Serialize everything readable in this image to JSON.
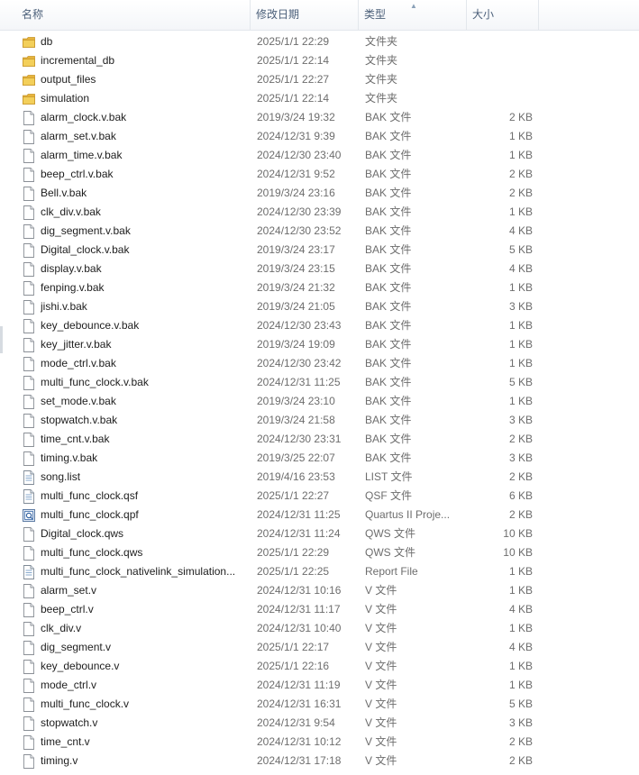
{
  "columns": {
    "name": "名称",
    "date": "修改日期",
    "type": "类型",
    "size": "大小"
  },
  "files": [
    {
      "name": "db",
      "date": "2025/1/1 22:29",
      "type": "文件夹",
      "size": "",
      "icon": "folder"
    },
    {
      "name": "incremental_db",
      "date": "2025/1/1 22:14",
      "type": "文件夹",
      "size": "",
      "icon": "folder"
    },
    {
      "name": "output_files",
      "date": "2025/1/1 22:27",
      "type": "文件夹",
      "size": "",
      "icon": "folder"
    },
    {
      "name": "simulation",
      "date": "2025/1/1 22:14",
      "type": "文件夹",
      "size": "",
      "icon": "folder"
    },
    {
      "name": "alarm_clock.v.bak",
      "date": "2019/3/24 19:32",
      "type": "BAK 文件",
      "size": "2 KB",
      "icon": "file"
    },
    {
      "name": "alarm_set.v.bak",
      "date": "2024/12/31 9:39",
      "type": "BAK 文件",
      "size": "1 KB",
      "icon": "file"
    },
    {
      "name": "alarm_time.v.bak",
      "date": "2024/12/30 23:40",
      "type": "BAK 文件",
      "size": "1 KB",
      "icon": "file"
    },
    {
      "name": "beep_ctrl.v.bak",
      "date": "2024/12/31 9:52",
      "type": "BAK 文件",
      "size": "2 KB",
      "icon": "file"
    },
    {
      "name": "Bell.v.bak",
      "date": "2019/3/24 23:16",
      "type": "BAK 文件",
      "size": "2 KB",
      "icon": "file"
    },
    {
      "name": "clk_div.v.bak",
      "date": "2024/12/30 23:39",
      "type": "BAK 文件",
      "size": "1 KB",
      "icon": "file"
    },
    {
      "name": "dig_segment.v.bak",
      "date": "2024/12/30 23:52",
      "type": "BAK 文件",
      "size": "4 KB",
      "icon": "file"
    },
    {
      "name": "Digital_clock.v.bak",
      "date": "2019/3/24 23:17",
      "type": "BAK 文件",
      "size": "5 KB",
      "icon": "file"
    },
    {
      "name": "display.v.bak",
      "date": "2019/3/24 23:15",
      "type": "BAK 文件",
      "size": "4 KB",
      "icon": "file"
    },
    {
      "name": "fenping.v.bak",
      "date": "2019/3/24 21:32",
      "type": "BAK 文件",
      "size": "1 KB",
      "icon": "file"
    },
    {
      "name": "jishi.v.bak",
      "date": "2019/3/24 21:05",
      "type": "BAK 文件",
      "size": "3 KB",
      "icon": "file"
    },
    {
      "name": "key_debounce.v.bak",
      "date": "2024/12/30 23:43",
      "type": "BAK 文件",
      "size": "1 KB",
      "icon": "file"
    },
    {
      "name": "key_jitter.v.bak",
      "date": "2019/3/24 19:09",
      "type": "BAK 文件",
      "size": "1 KB",
      "icon": "file"
    },
    {
      "name": "mode_ctrl.v.bak",
      "date": "2024/12/30 23:42",
      "type": "BAK 文件",
      "size": "1 KB",
      "icon": "file"
    },
    {
      "name": "multi_func_clock.v.bak",
      "date": "2024/12/31 11:25",
      "type": "BAK 文件",
      "size": "5 KB",
      "icon": "file"
    },
    {
      "name": "set_mode.v.bak",
      "date": "2019/3/24 23:10",
      "type": "BAK 文件",
      "size": "1 KB",
      "icon": "file"
    },
    {
      "name": "stopwatch.v.bak",
      "date": "2019/3/24 21:58",
      "type": "BAK 文件",
      "size": "3 KB",
      "icon": "file"
    },
    {
      "name": "time_cnt.v.bak",
      "date": "2024/12/30 23:31",
      "type": "BAK 文件",
      "size": "2 KB",
      "icon": "file"
    },
    {
      "name": "timing.v.bak",
      "date": "2019/3/25 22:07",
      "type": "BAK 文件",
      "size": "3 KB",
      "icon": "file"
    },
    {
      "name": "song.list",
      "date": "2019/4/16 23:53",
      "type": "LIST 文件",
      "size": "2 KB",
      "icon": "file-doc"
    },
    {
      "name": "multi_func_clock.qsf",
      "date": "2025/1/1 22:27",
      "type": "QSF 文件",
      "size": "6 KB",
      "icon": "file-doc"
    },
    {
      "name": "multi_func_clock.qpf",
      "date": "2024/12/31 11:25",
      "type": "Quartus II Proje...",
      "size": "2 KB",
      "icon": "quartus"
    },
    {
      "name": "Digital_clock.qws",
      "date": "2024/12/31 11:24",
      "type": "QWS 文件",
      "size": "10 KB",
      "icon": "file"
    },
    {
      "name": "multi_func_clock.qws",
      "date": "2025/1/1 22:29",
      "type": "QWS 文件",
      "size": "10 KB",
      "icon": "file"
    },
    {
      "name": "multi_func_clock_nativelink_simulation...",
      "date": "2025/1/1 22:25",
      "type": "Report File",
      "size": "1 KB",
      "icon": "file-doc"
    },
    {
      "name": "alarm_set.v",
      "date": "2024/12/31 10:16",
      "type": "V 文件",
      "size": "1 KB",
      "icon": "file"
    },
    {
      "name": "beep_ctrl.v",
      "date": "2024/12/31 11:17",
      "type": "V 文件",
      "size": "4 KB",
      "icon": "file"
    },
    {
      "name": "clk_div.v",
      "date": "2024/12/31 10:40",
      "type": "V 文件",
      "size": "1 KB",
      "icon": "file"
    },
    {
      "name": "dig_segment.v",
      "date": "2025/1/1 22:17",
      "type": "V 文件",
      "size": "4 KB",
      "icon": "file"
    },
    {
      "name": "key_debounce.v",
      "date": "2025/1/1 22:16",
      "type": "V 文件",
      "size": "1 KB",
      "icon": "file"
    },
    {
      "name": "mode_ctrl.v",
      "date": "2024/12/31 11:19",
      "type": "V 文件",
      "size": "1 KB",
      "icon": "file"
    },
    {
      "name": "multi_func_clock.v",
      "date": "2024/12/31 16:31",
      "type": "V 文件",
      "size": "5 KB",
      "icon": "file"
    },
    {
      "name": "stopwatch.v",
      "date": "2024/12/31 9:54",
      "type": "V 文件",
      "size": "3 KB",
      "icon": "file"
    },
    {
      "name": "time_cnt.v",
      "date": "2024/12/31 10:12",
      "type": "V 文件",
      "size": "2 KB",
      "icon": "file"
    },
    {
      "name": "timing.v",
      "date": "2024/12/31 17:18",
      "type": "V 文件",
      "size": "2 KB",
      "icon": "file"
    }
  ]
}
